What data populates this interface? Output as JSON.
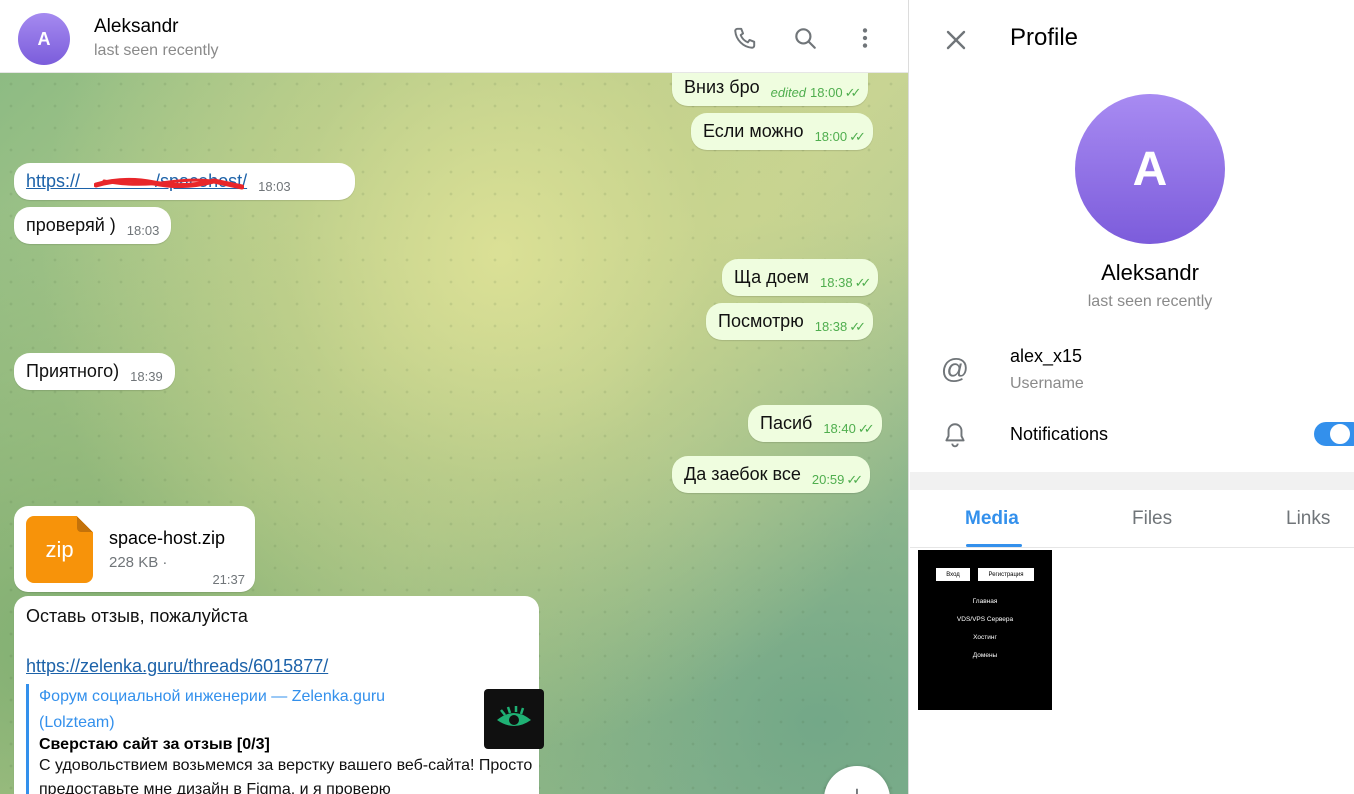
{
  "chat": {
    "header": {
      "avatar_letter": "A",
      "name": "Aleksandr",
      "status": "last seen recently"
    },
    "messages": [
      {
        "dir": "out",
        "text": "Вниз бро",
        "edited": "edited",
        "time": "18:00",
        "ticks": "✓✓"
      },
      {
        "dir": "out",
        "text": "Если можно",
        "time": "18:00",
        "ticks": "✓✓"
      },
      {
        "dir": "in",
        "text": "https://               /spacehost/",
        "time": "18:03"
      },
      {
        "dir": "in",
        "text": "проверяй )",
        "time": "18:03"
      },
      {
        "dir": "out",
        "text": "Ща доем",
        "time": "18:38",
        "ticks": "✓✓"
      },
      {
        "dir": "out",
        "text": "Посмотрю",
        "time": "18:38",
        "ticks": "✓✓"
      },
      {
        "dir": "in",
        "text": "Приятного)",
        "time": "18:39"
      },
      {
        "dir": "out",
        "text": "Пасиб",
        "time": "18:40",
        "ticks": "✓✓"
      },
      {
        "dir": "out",
        "text": "Да заебок все",
        "time": "20:59",
        "ticks": "✓✓"
      }
    ],
    "file": {
      "icon_label": "zip",
      "name": "space-host.zip",
      "size": "228 KB ·",
      "time": "21:37"
    },
    "link_message": {
      "text": "Оставь отзыв, пожалуйста",
      "url": "https://zelenka.guru/threads/6015877/",
      "preview": {
        "site": "Форум социальной инженерии —  Zelenka.guru (Lolzteam)",
        "title": "Сверстаю сайт за отзыв [0/3]",
        "description": "С удовольствием возьмемся за верстку вашего веб-сайта! Просто предоставьте мне дизайн в Figma, и я проверю"
      }
    }
  },
  "profile": {
    "title": "Profile",
    "avatar_letter": "A",
    "name": "Aleksandr",
    "status": "last seen recently",
    "username": "alex_x15",
    "username_label": "Username",
    "notifications_label": "Notifications",
    "notifications_on": true,
    "tabs": [
      {
        "label": "Media",
        "active": true
      },
      {
        "label": "Files",
        "active": false
      },
      {
        "label": "Links",
        "active": false
      }
    ],
    "media_thumb": {
      "buttons": [
        "Вход",
        "Регистрация"
      ],
      "menu": [
        "Главная",
        "VDS/VPS Сервера",
        "Хостинг",
        "Домены"
      ]
    }
  },
  "colors": {
    "accent": "#3390ec",
    "outgoing_bubble": "#effddf",
    "read_ticks": "#4fae4e",
    "avatar": "#8b6fe3",
    "zip": "#f7930a"
  },
  "icons": [
    "phone-icon",
    "search-icon",
    "more-vertical-icon",
    "close-icon",
    "at-icon",
    "bell-icon",
    "plus-icon"
  ]
}
